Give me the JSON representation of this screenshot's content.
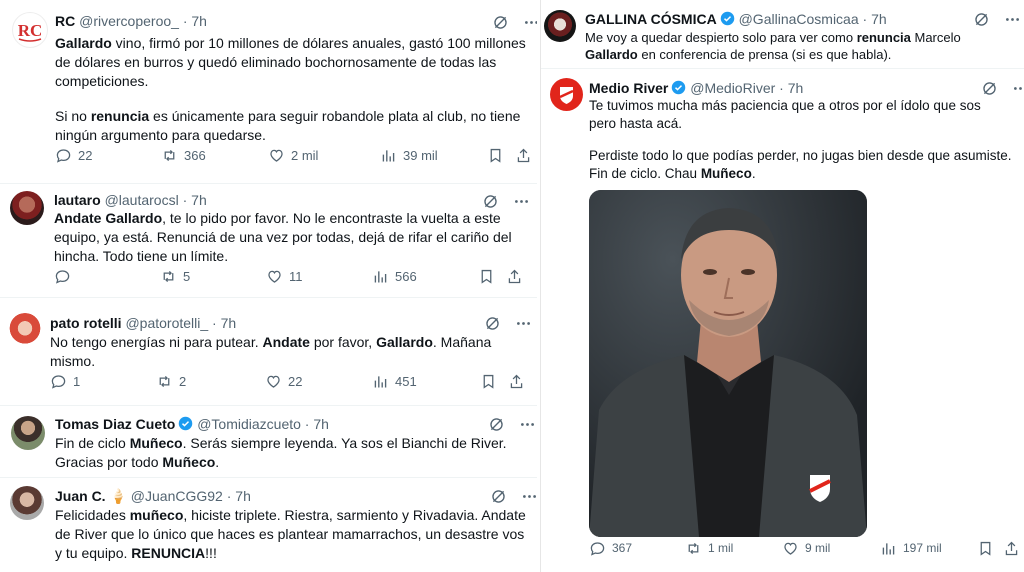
{
  "left_column": [
    {
      "name": "RC",
      "handle": "@rivercoperoo_",
      "time": "7h",
      "body_parts": [
        {
          "t": "Gallardo",
          "b": true
        },
        {
          "t": " vino, firmó por 10 millones de dólares anuales, gastó 100 millones de dólares en burros y quedó eliminado bochornosamente de todas las competiciones.",
          "b": false
        }
      ],
      "body2_parts": [
        {
          "t": "Si no ",
          "b": false
        },
        {
          "t": "renuncia",
          "b": true
        },
        {
          "t": " es únicamente para seguir robandole plata al club, no tiene ningún argumento para quedarse.",
          "b": false
        }
      ],
      "replies": "22",
      "retweets": "366",
      "likes": "2 mil",
      "views": "39 mil"
    },
    {
      "name": "lautaro",
      "handle": "@lautarocsl",
      "time": "7h",
      "body_parts": [
        {
          "t": "Andate Gallardo",
          "b": true
        },
        {
          "t": ", te lo pido por favor. No le encontraste la vuelta a este equipo, ya está. Renunciá de una vez por todas, dejá de rifar el cariño del hincha. Todo tiene un límite.",
          "b": false
        }
      ],
      "replies": "",
      "retweets": "5",
      "likes": "11",
      "views": "566"
    },
    {
      "name": "pato rotelli",
      "handle": "@patorotelli_",
      "time": "7h",
      "body_parts": [
        {
          "t": "No tengo energías ni para putear. ",
          "b": false
        },
        {
          "t": "Andate",
          "b": true
        },
        {
          "t": " por favor, ",
          "b": false
        },
        {
          "t": "Gallardo",
          "b": true
        },
        {
          "t": ". Mañana mismo.",
          "b": false
        }
      ],
      "replies": "1",
      "retweets": "2",
      "likes": "22",
      "views": "451"
    },
    {
      "name": "Tomas Diaz Cueto",
      "handle": "@Tomidiazcueto",
      "time": "7h",
      "body_parts": [
        {
          "t": "Fin de ciclo ",
          "b": false
        },
        {
          "t": "Muñeco",
          "b": true
        },
        {
          "t": ". Serás siempre leyenda. Ya sos el Bianchi de River. Gracias por todo ",
          "b": false
        },
        {
          "t": "Muñeco",
          "b": true
        },
        {
          "t": ".",
          "b": false
        }
      ]
    },
    {
      "name": "Juan C.",
      "handle": "@JuanCGG92",
      "time": "7h",
      "emoji": "🍦",
      "body_parts": [
        {
          "t": "Felicidades ",
          "b": false
        },
        {
          "t": "muñeco",
          "b": true
        },
        {
          "t": ", hiciste triplete. Riestra, sarmiento y Rivadavia. Andate de River que lo único que haces es plantear mamarrachos, un desastre vos y tu equipo. ",
          "b": false
        },
        {
          "t": "RENUNCIA",
          "b": true
        },
        {
          "t": "!!!",
          "b": false
        }
      ]
    }
  ],
  "right_column": [
    {
      "name": "GALLINA CÓSMICA",
      "handle": "@GallinaCosmicaa",
      "time": "7h",
      "body_parts": [
        {
          "t": "Me voy a quedar despierto solo para ver como ",
          "b": false
        },
        {
          "t": "renuncia",
          "b": true
        },
        {
          "t": " Marcelo ",
          "b": false
        },
        {
          "t": "Gallardo",
          "b": true
        },
        {
          "t": " en conferencia de prensa (si es que habla).",
          "b": false
        }
      ]
    },
    {
      "name": "Medio River",
      "handle": "@MedioRiver",
      "time": "7h",
      "body_parts": [
        {
          "t": "Te tuvimos mucha más paciencia que a otros por el ídolo que sos pero hasta acá.",
          "b": false
        }
      ],
      "body2_parts": [
        {
          "t": "Perdiste todo lo que podías perder, no jugas bien desde que asumiste. Fin de ciclo. Chau ",
          "b": false
        },
        {
          "t": "Muñeco",
          "b": true
        },
        {
          "t": ".",
          "b": false
        }
      ],
      "replies": "367",
      "retweets": "1 mil",
      "likes": "9 mil",
      "views": "197 mil"
    }
  ],
  "colors": {
    "verified": "#1d9bf0",
    "muted": "#536471",
    "text": "#0f1419",
    "river_red": "#e1251b"
  }
}
